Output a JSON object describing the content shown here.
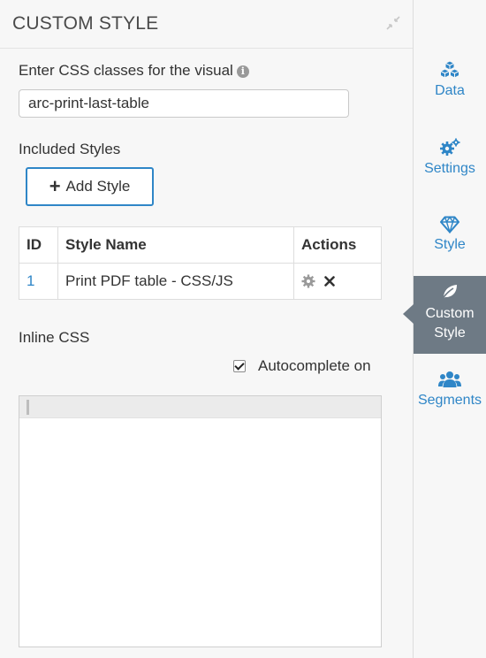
{
  "panel": {
    "title": "CUSTOM STYLE",
    "css_classes_label": "Enter CSS classes for the visual",
    "css_classes_value": "arc-print-last-table",
    "included_styles_label": "Included Styles",
    "add_style_label": "Add Style",
    "table": {
      "headers": [
        "ID",
        "Style Name",
        "Actions"
      ],
      "rows": [
        {
          "id": "1",
          "style_name": "Print PDF table - CSS/JS"
        }
      ]
    },
    "inline_css_label": "Inline CSS",
    "autocomplete_label": "Autocomplete on",
    "autocomplete_checked": true
  },
  "sidebar": {
    "items": [
      {
        "label": "Data",
        "icon": "cubes-icon"
      },
      {
        "label": "Settings",
        "icon": "gears-icon"
      },
      {
        "label": "Style",
        "icon": "diamond-icon"
      },
      {
        "label_line1": "Custom",
        "label_line2": "Style",
        "icon": "leaf-icon",
        "active": true
      },
      {
        "label": "Segments",
        "icon": "users-icon"
      }
    ]
  },
  "colors": {
    "accent": "#2f86c7",
    "active_tab": "#6e7a85",
    "background": "#f7f7f7"
  }
}
